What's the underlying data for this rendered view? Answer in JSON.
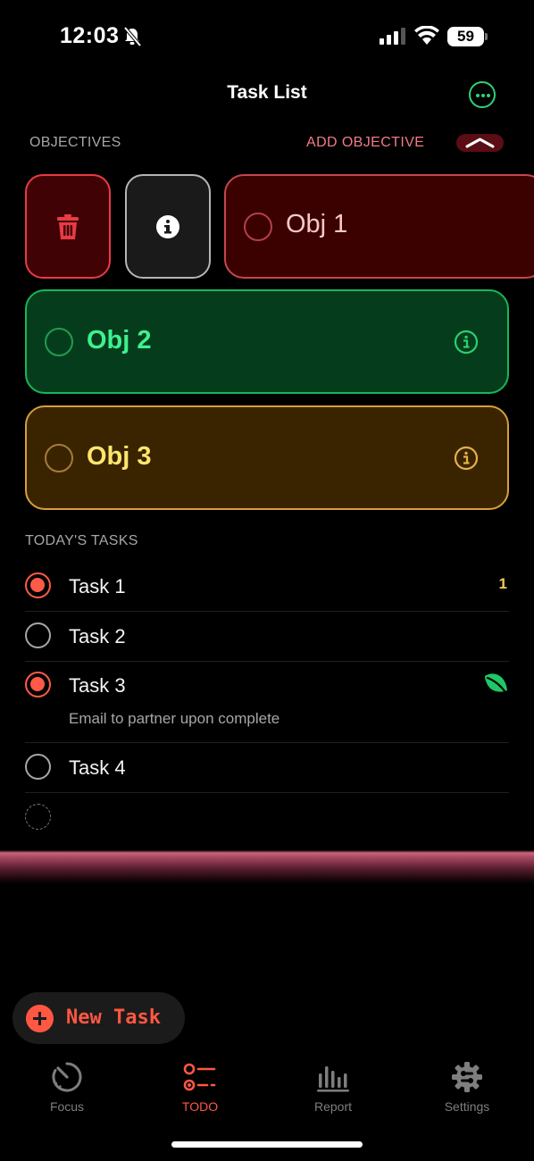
{
  "status_bar": {
    "time": "12:03",
    "battery": "59"
  },
  "header": {
    "title": "Task List"
  },
  "objectives": {
    "section_label": "OBJECTIVES",
    "add_label": "ADD OBJECTIVE",
    "items": [
      {
        "label": "Obj 1",
        "color": "#c3484c"
      },
      {
        "label": "Obj 2",
        "color": "#19b558"
      },
      {
        "label": "Obj 3",
        "color": "#d89f3c"
      }
    ]
  },
  "tasks": {
    "section_label": "TODAY'S TASKS",
    "items": [
      {
        "name": "Task 1",
        "done": true,
        "badge": "1"
      },
      {
        "name": "Task 2",
        "done": false
      },
      {
        "name": "Task 3",
        "done": true,
        "note": "Email to partner upon complete",
        "icon": "leaf-icon"
      },
      {
        "name": "Task 4",
        "done": false
      }
    ]
  },
  "new_task": {
    "label": "New Task"
  },
  "tab_bar": {
    "items": [
      {
        "label": "Focus",
        "icon": "timer-icon"
      },
      {
        "label": "TODO",
        "icon": "list-icon",
        "active": true
      },
      {
        "label": "Report",
        "icon": "bar-chart-icon"
      },
      {
        "label": "Settings",
        "icon": "gear-icon"
      }
    ]
  },
  "colors": {
    "accent": "#ff5742",
    "green": "#2fd17a"
  }
}
